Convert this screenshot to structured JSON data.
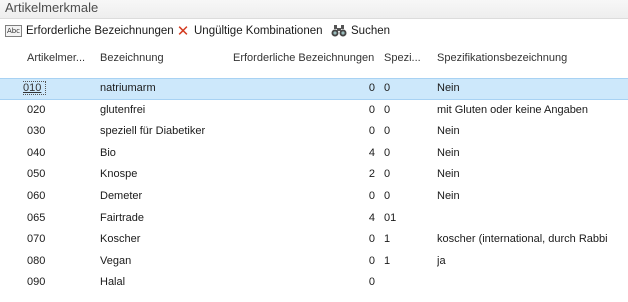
{
  "window": {
    "title": "Artikelmerkmale"
  },
  "toolbar": {
    "required_names_label": "Erforderliche Bezeichnungen",
    "invalid_combinations_label": "Ungültige Kombinationen",
    "search_label": "Suchen",
    "abc_icon_text": "Abc"
  },
  "columns": {
    "code": "Artikelmer...",
    "name": "Bezeichnung",
    "required": "Erforderliche Bezeichnungen",
    "spec": "Spezi...",
    "spec_name": "Spezifikationsbezeichnung"
  },
  "rows": [
    {
      "code": "010",
      "name": "natriumarm",
      "required": "0",
      "spec": "0",
      "spec_name": "Nein",
      "selected": true
    },
    {
      "code": "020",
      "name": "glutenfrei",
      "required": "0",
      "spec": "0",
      "spec_name": "mit Gluten oder keine Angaben"
    },
    {
      "code": "030",
      "name": "speziell für Diabetiker",
      "required": "0",
      "spec": "0",
      "spec_name": "Nein"
    },
    {
      "code": "040",
      "name": "Bio",
      "required": "4",
      "spec": "0",
      "spec_name": "Nein"
    },
    {
      "code": "050",
      "name": "Knospe",
      "required": "2",
      "spec": "0",
      "spec_name": "Nein"
    },
    {
      "code": "060",
      "name": "Demeter",
      "required": "0",
      "spec": "0",
      "spec_name": "Nein"
    },
    {
      "code": "065",
      "name": "Fairtrade",
      "required": "4",
      "spec": "01",
      "spec_name": ""
    },
    {
      "code": "070",
      "name": "Koscher",
      "required": "0",
      "spec": "1",
      "spec_name": "koscher (international, durch Rabbi"
    },
    {
      "code": "080",
      "name": "Vegan",
      "required": "0",
      "spec": "1",
      "spec_name": "ja"
    },
    {
      "code": "090",
      "name": "Halal",
      "required": "0",
      "spec": "",
      "spec_name": ""
    }
  ],
  "colors": {
    "selection": "#cde8fb",
    "delete_red": "#d33a1f"
  },
  "icons": {
    "required_names": "abc-icon",
    "invalid_combinations": "x-icon",
    "search": "binoculars-icon"
  }
}
